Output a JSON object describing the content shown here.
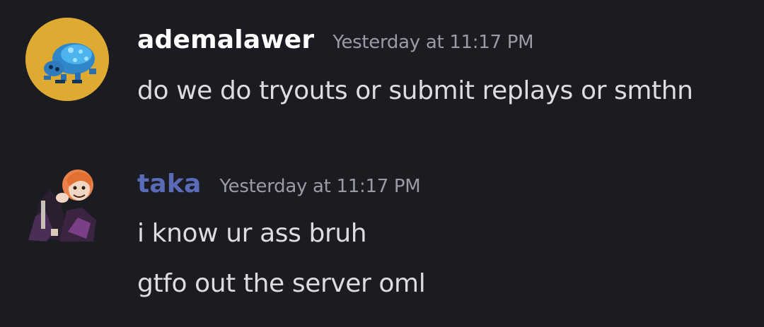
{
  "messages": [
    {
      "username": "ademalawer",
      "username_color": "#ffffff",
      "timestamp": "Yesterday at 11:17 PM",
      "avatar_icon": "blue-bug-avatar-icon",
      "lines": [
        "do we do tryouts or submit replays or smthn"
      ]
    },
    {
      "username": "taka",
      "username_color": "#5a6bb8",
      "timestamp": "Yesterday at 11:17 PM",
      "avatar_icon": "anime-character-avatar-icon",
      "lines": [
        "i know ur ass bruh",
        "gtfo out the server oml"
      ]
    }
  ],
  "colors": {
    "background": "#1b1b22",
    "text": "#dcdde2",
    "timestamp": "#9a9ba3"
  }
}
